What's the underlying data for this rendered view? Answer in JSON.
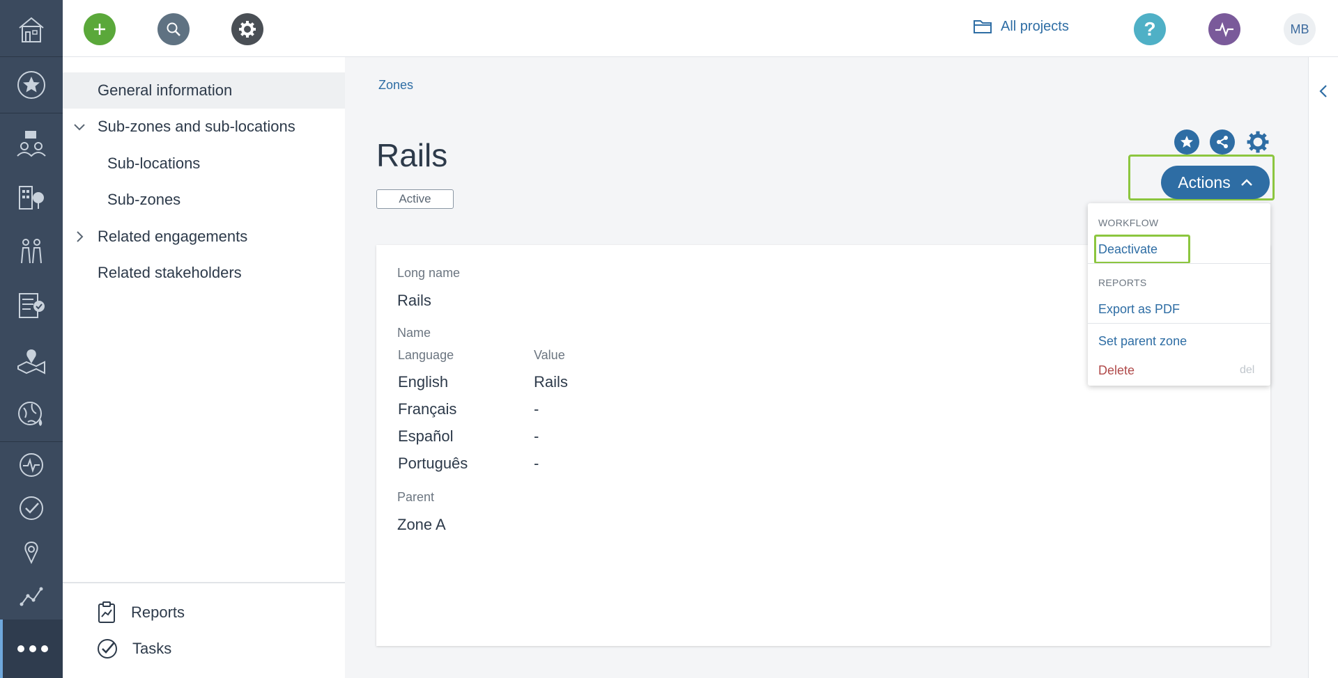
{
  "topbar": {
    "all_projects_label": "All projects",
    "avatar_initials": "MB"
  },
  "colors": {
    "add_button": "#5aa83a",
    "search_button": "#5f7282",
    "settings_button": "#4a4f55",
    "help_button": "#4fb0c6",
    "pulse_button": "#7a5a9a",
    "accent": "#2e6da4",
    "highlight": "#8cc63f",
    "delete": "#b04a4a"
  },
  "sidenav": {
    "items": [
      {
        "label": "General information"
      },
      {
        "label": "Sub-zones and sub-locations"
      },
      {
        "label": "Sub-locations"
      },
      {
        "label": "Sub-zones"
      },
      {
        "label": "Related engagements"
      },
      {
        "label": "Related stakeholders"
      }
    ],
    "bottom": [
      {
        "label": "Reports"
      },
      {
        "label": "Tasks"
      }
    ]
  },
  "main": {
    "breadcrumb": "Zones",
    "title": "Rails",
    "status": "Active",
    "actions_label": "Actions"
  },
  "card": {
    "long_name_label": "Long name",
    "long_name_value": "Rails",
    "name_label": "Name",
    "table_headers": [
      "Language",
      "Value"
    ],
    "rows": [
      {
        "language": "English",
        "value": "Rails"
      },
      {
        "language": "Français",
        "value": "-"
      },
      {
        "language": "Español",
        "value": "-"
      },
      {
        "language": "Português",
        "value": "-"
      }
    ],
    "parent_label": "Parent",
    "parent_value": "Zone A"
  },
  "dropdown": {
    "workflow_header": "WORKFLOW",
    "deactivate": "Deactivate",
    "reports_header": "REPORTS",
    "export_pdf": "Export as PDF",
    "set_parent": "Set parent zone",
    "delete": "Delete",
    "delete_shortcut": "del"
  }
}
